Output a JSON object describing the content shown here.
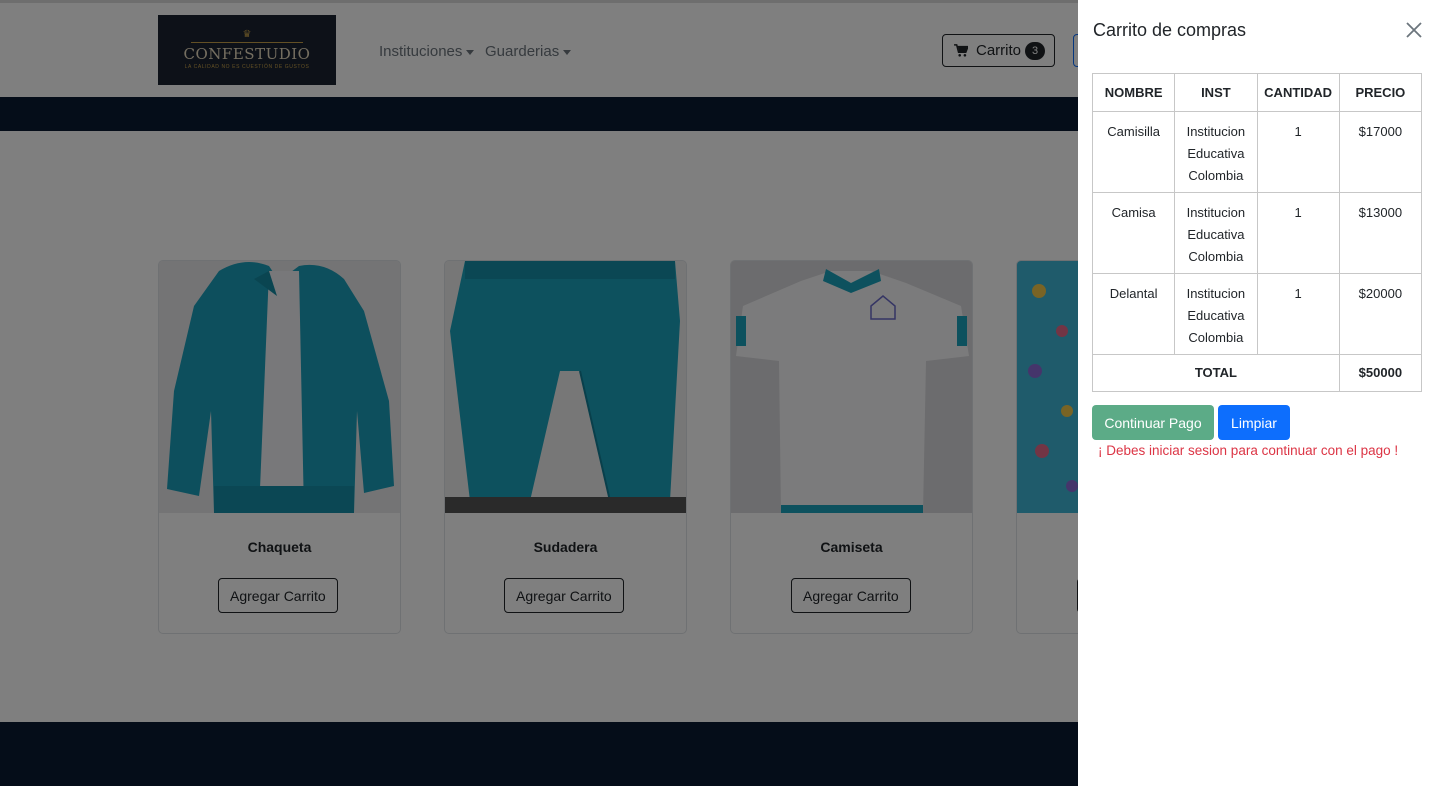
{
  "brand": {
    "name": "CONFESTUDIO",
    "tagline": "LA CALIDAD NO ES CUESTIÓN DE GUSTOS"
  },
  "nav": {
    "menus": [
      "Instituciones",
      "Guarderias"
    ],
    "cart_label": "Carrito",
    "cart_count": "3"
  },
  "products": [
    {
      "name": "Chaqueta",
      "button": "Agregar Carrito"
    },
    {
      "name": "Sudadera",
      "button": "Agregar Carrito"
    },
    {
      "name": "Camiseta",
      "button": "Agregar Carrito"
    }
  ],
  "offcanvas": {
    "title": "Carrito de compras",
    "headers": [
      "NOMBRE",
      "INST",
      "CANTIDAD",
      "PRECIO"
    ],
    "rows": [
      {
        "name": "Camisilla",
        "inst": "Institucion Educativa Colombia",
        "qty": "1",
        "price": "$17000"
      },
      {
        "name": "Camisa",
        "inst": "Institucion Educativa Colombia",
        "qty": "1",
        "price": "$13000"
      },
      {
        "name": "Delantal",
        "inst": "Institucion Educativa Colombia",
        "qty": "1",
        "price": "$20000"
      }
    ],
    "total_label": "TOTAL",
    "total_value": "$50000",
    "pay_button": "Continuar Pago",
    "clear_button": "Limpiar",
    "warning": "¡ Debes iniciar sesion para continuar con el pago !"
  },
  "colors": {
    "navy": "#0b1b33",
    "teal_uniform": "#1a9fba",
    "pay_button": "#5cab87",
    "clear_button": "#0d6efd",
    "warning": "#dc3545"
  }
}
